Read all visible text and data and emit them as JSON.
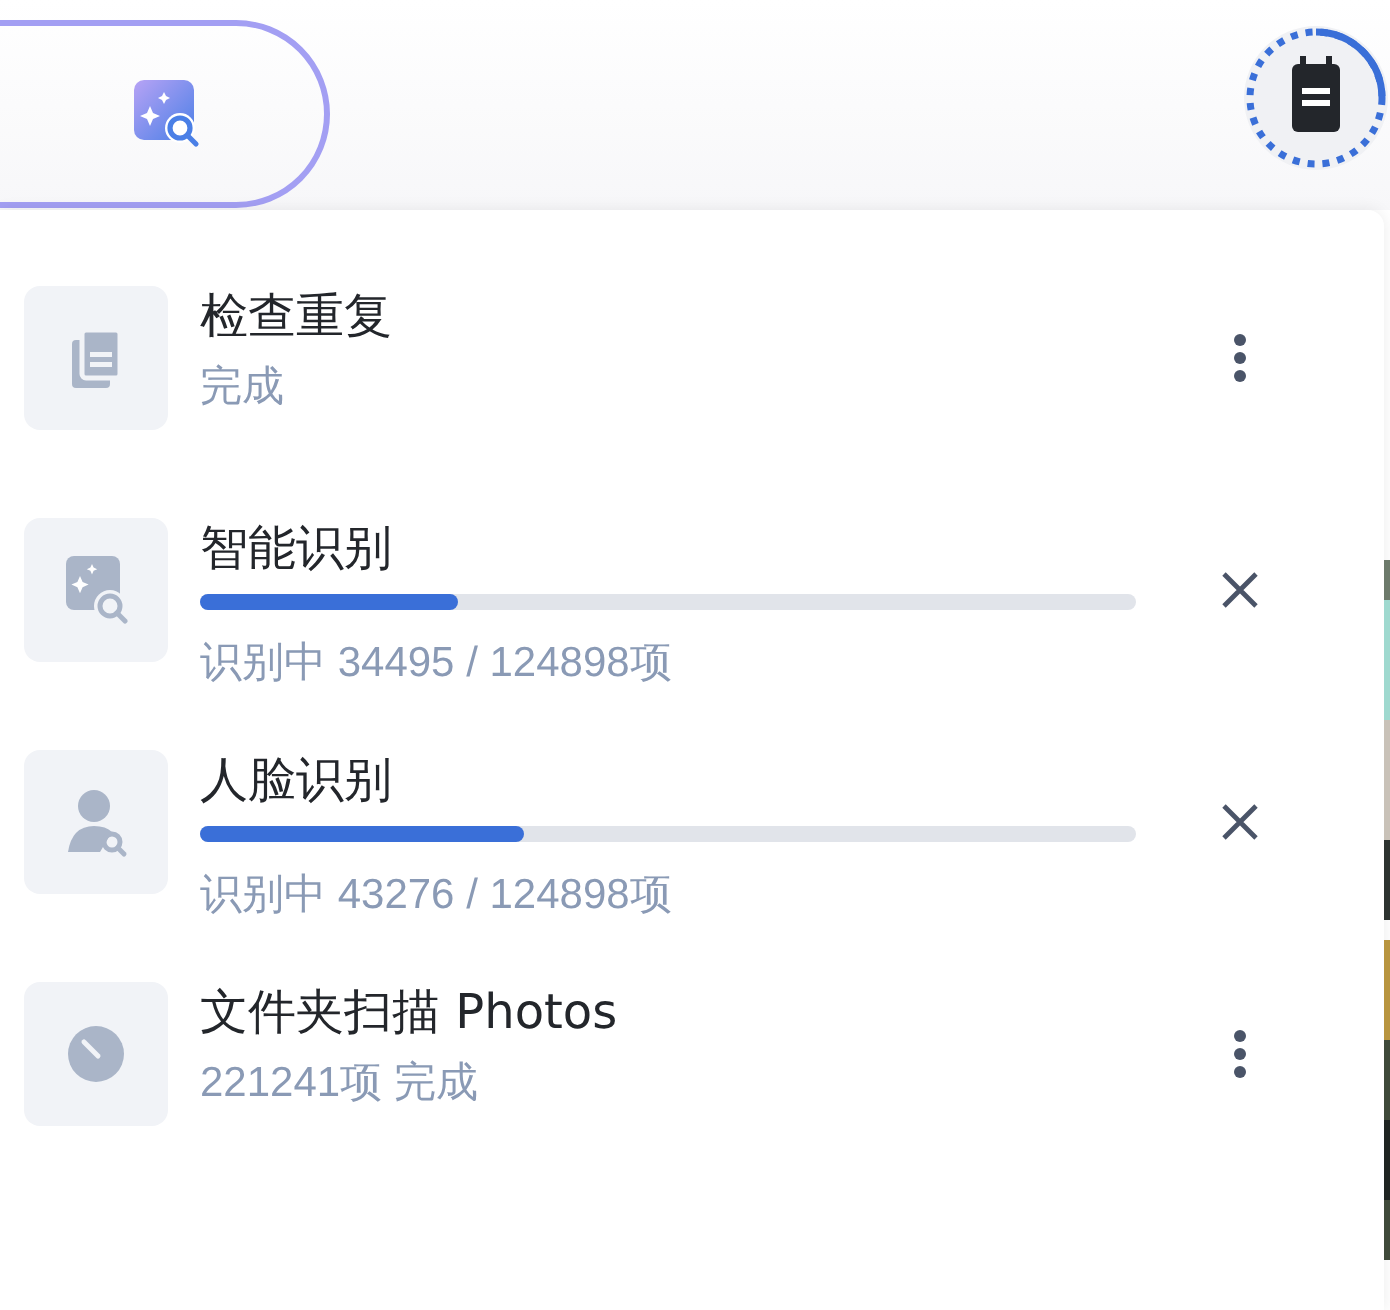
{
  "tasks": [
    {
      "kind": "done",
      "title": "检查重复",
      "status": "完成"
    },
    {
      "kind": "progress",
      "title": "智能识别",
      "level": 0.276,
      "status": "识别中 34495 / 124898项"
    },
    {
      "kind": "progress",
      "title": "人脸识别",
      "level": 0.346,
      "status": "识别中 43276 / 124898项"
    },
    {
      "kind": "done",
      "title": "文件夹扫描 Photos",
      "status": "221241项 完成"
    }
  ]
}
